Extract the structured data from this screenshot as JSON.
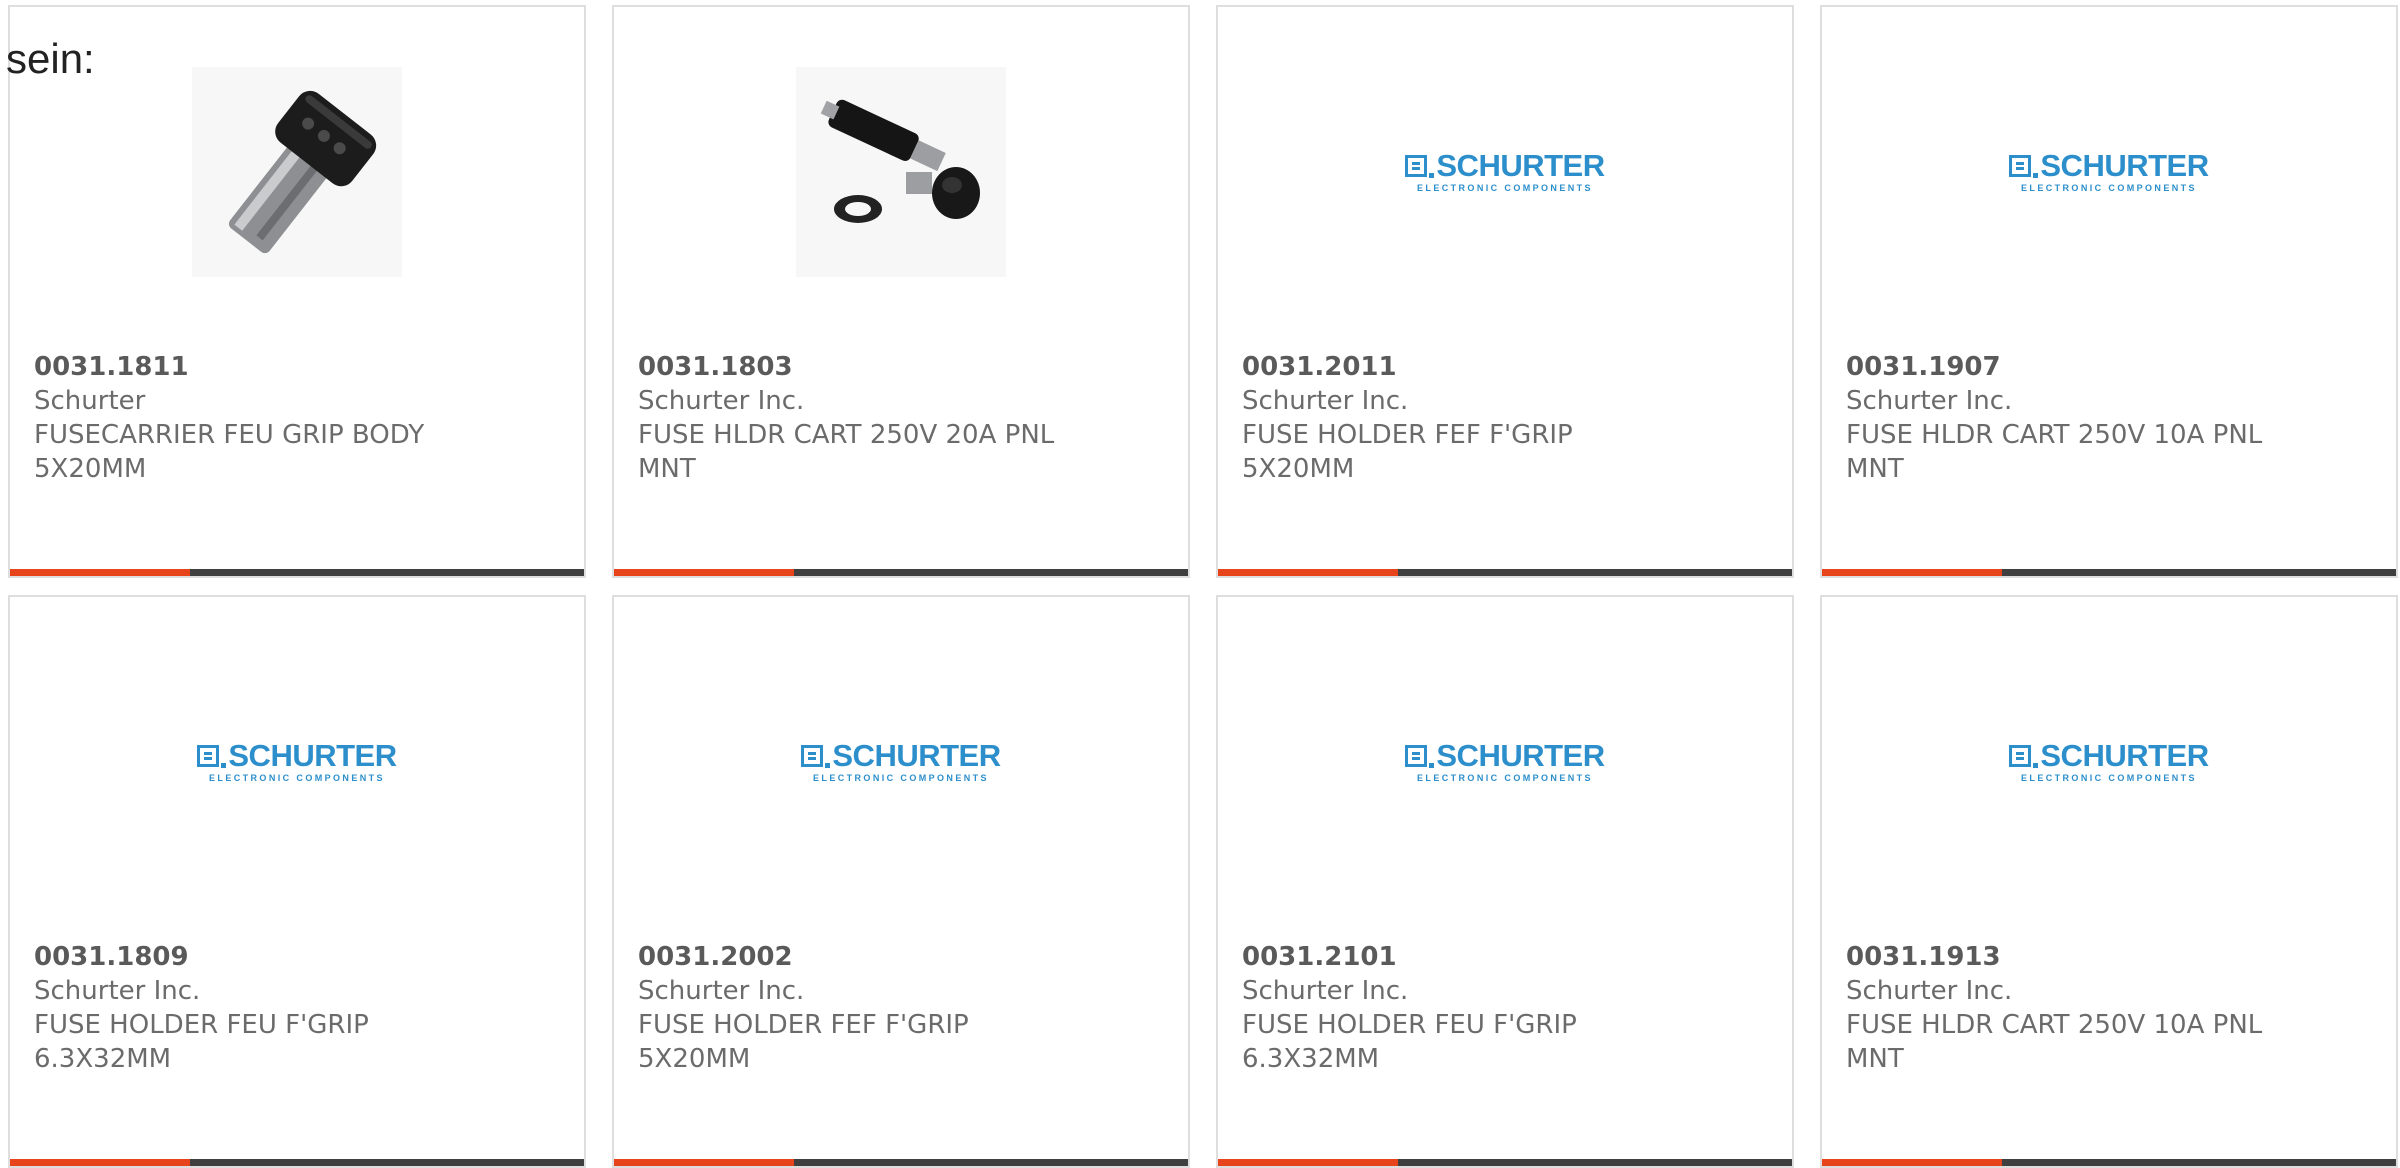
{
  "intro_text": "sein:",
  "colors": {
    "accent": "#e8441b",
    "bar": "#3f3f3f",
    "brand_logo": "#2c8fcb"
  },
  "logo": {
    "word": "SCHURTER",
    "sub": "ELECTRONIC COMPONENTS"
  },
  "products": [
    {
      "part_number": "0031.1811",
      "manufacturer": "Schurter",
      "description": "FUSECARRIER FEU GRIP BODY 5X20MM",
      "image": "fuse-carrier-photo"
    },
    {
      "part_number": "0031.1803",
      "manufacturer": "Schurter Inc.",
      "description": "FUSE HLDR CART 250V 20A PNL MNT",
      "image": "fuse-holder-parts-photo"
    },
    {
      "part_number": "0031.2011",
      "manufacturer": "Schurter Inc.",
      "description": "FUSE HOLDER FEF F'GRIP 5X20MM",
      "image": "schurter-logo"
    },
    {
      "part_number": "0031.1907",
      "manufacturer": "Schurter Inc.",
      "description": "FUSE HLDR CART 250V 10A PNL MNT",
      "image": "schurter-logo"
    },
    {
      "part_number": "0031.1809",
      "manufacturer": "Schurter Inc.",
      "description": "FUSE HOLDER FEU F'GRIP 6.3X32MM",
      "image": "schurter-logo"
    },
    {
      "part_number": "0031.2002",
      "manufacturer": "Schurter Inc.",
      "description": "FUSE HOLDER FEF F'GRIP 5X20MM",
      "image": "schurter-logo"
    },
    {
      "part_number": "0031.2101",
      "manufacturer": "Schurter Inc.",
      "description": "FUSE HOLDER FEU F'GRIP 6.3X32MM",
      "image": "schurter-logo"
    },
    {
      "part_number": "0031.1913",
      "manufacturer": "Schurter Inc.",
      "description": "FUSE HLDR CART 250V 10A PNL MNT",
      "image": "schurter-logo"
    }
  ]
}
